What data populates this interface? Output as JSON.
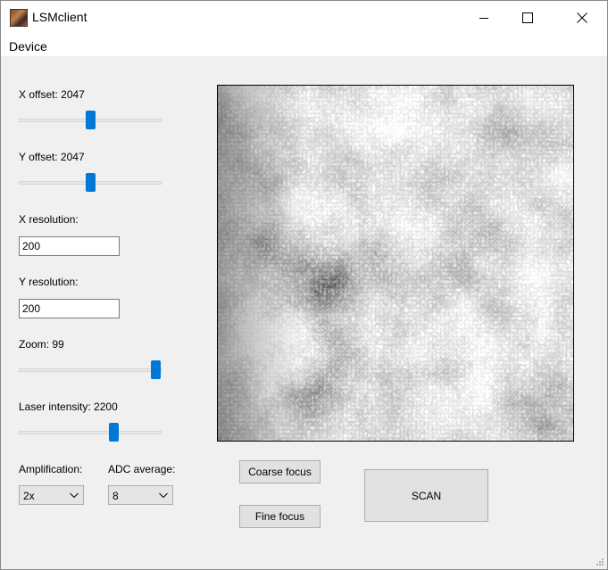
{
  "window": {
    "title": "LSMclient"
  },
  "menu": {
    "items": [
      "Device"
    ]
  },
  "controls": {
    "x_offset_label": "X offset: 2047",
    "x_offset_value": 0.5,
    "y_offset_label": "Y offset: 2047",
    "y_offset_value": 0.5,
    "x_resolution_label": "X resolution:",
    "x_resolution_value": "200",
    "y_resolution_label": "Y resolution:",
    "y_resolution_value": "200",
    "zoom_label": "Zoom: 99",
    "zoom_value": 0.99,
    "laser_label": "Laser intensity: 2200",
    "laser_value": 0.68,
    "amplification_label": "Amplification:",
    "amplification_value": "2x",
    "adc_label": "ADC average:",
    "adc_value": "8"
  },
  "buttons": {
    "coarse_focus": "Coarse focus",
    "fine_focus": "Fine focus",
    "scan": "SCAN"
  },
  "colors": {
    "slider_thumb": "#0078d7",
    "accent": "#0078d7"
  },
  "icons": [
    "app-icon",
    "minimize-icon",
    "maximize-icon",
    "close-icon",
    "chevron-down-icon",
    "resize-grip-icon"
  ]
}
